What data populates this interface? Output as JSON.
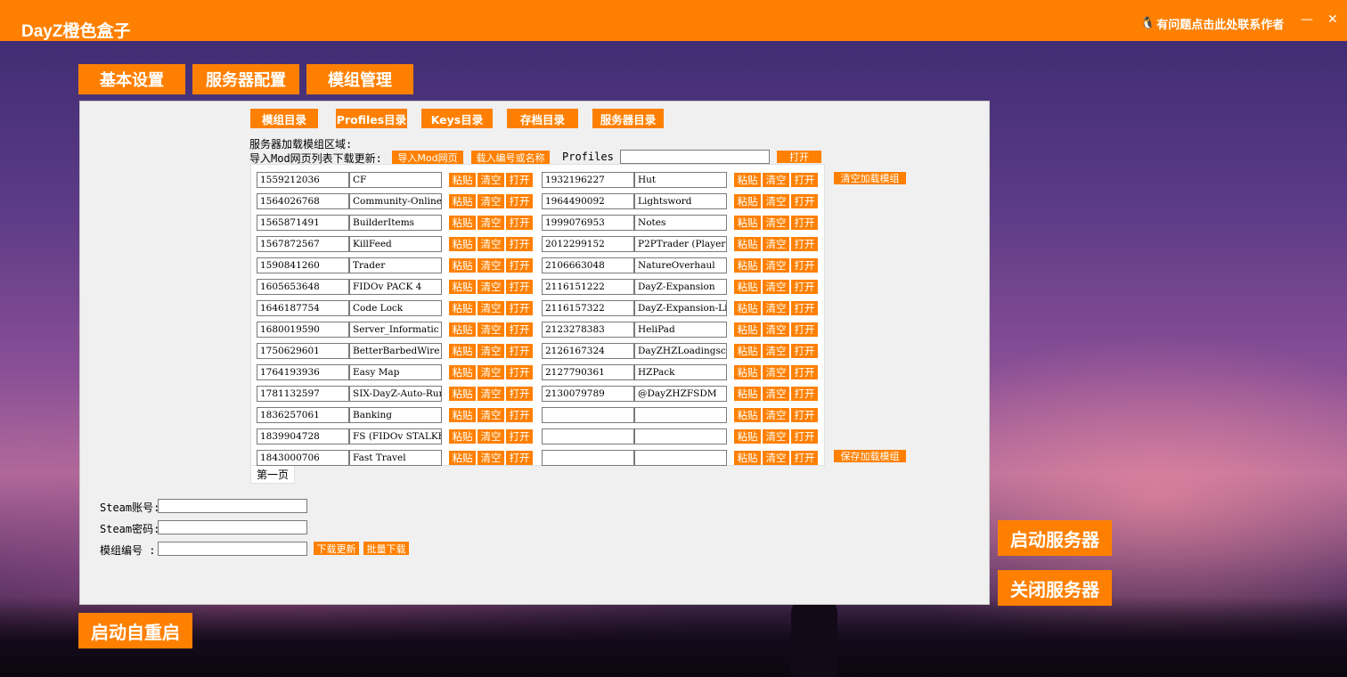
{
  "app": {
    "title": "DayZ橙色盒子",
    "contact_text": "有问题点击此处联系作者",
    "qq_icon": "qq-penguin-icon",
    "minimize": "—",
    "close": "✕"
  },
  "nav": {
    "tabs": [
      {
        "label": "基本设置"
      },
      {
        "label": "服务器配置"
      },
      {
        "label": "模组管理"
      }
    ]
  },
  "panel": {
    "dir_buttons": [
      {
        "label": "模组目录"
      },
      {
        "label": "Profiles目录"
      },
      {
        "label": "Keys目录"
      },
      {
        "label": "存档目录"
      },
      {
        "label": "服务器目录"
      }
    ],
    "load_area_label": "服务器加载模组区域:",
    "import_label": "导入Mod网页列表下载更新:",
    "import_button": "导入Mod网页",
    "load_button": "载入编号或名称",
    "profiles_label": "Profiles :",
    "profiles_value": "",
    "open_button": "打开",
    "clear_mods_button": "清空加载模组",
    "save_mods_button": "保存加载模组",
    "row_buttons": {
      "paste": "粘贴",
      "clear": "清空",
      "open": "打开"
    },
    "left_mods": [
      {
        "id": "1559212036",
        "name": "CF"
      },
      {
        "id": "1564026768",
        "name": "Community-Online-"
      },
      {
        "id": "1565871491",
        "name": "BuilderItems"
      },
      {
        "id": "1567872567",
        "name": "KillFeed"
      },
      {
        "id": "1590841260",
        "name": "Trader"
      },
      {
        "id": "1605653648",
        "name": "FIDOv PACK 4"
      },
      {
        "id": "1646187754",
        "name": "Code Lock"
      },
      {
        "id": "1680019590",
        "name": "Server_Informatic"
      },
      {
        "id": "1750629601",
        "name": "BetterBarbedWire"
      },
      {
        "id": "1764193936",
        "name": "Easy Map"
      },
      {
        "id": "1781132597",
        "name": "SIX-DayZ-Auto-Rur"
      },
      {
        "id": "1836257061",
        "name": "Banking"
      },
      {
        "id": "1839904728",
        "name": "FS (FIDOv STALKEF"
      },
      {
        "id": "1843000706",
        "name": "Fast Travel"
      }
    ],
    "right_mods": [
      {
        "id": "1932196227",
        "name": "Hut"
      },
      {
        "id": "1964490092",
        "name": "Lightsword"
      },
      {
        "id": "1999076953",
        "name": "Notes"
      },
      {
        "id": "2012299152",
        "name": "P2PTrader (Player"
      },
      {
        "id": "2106663048",
        "name": "NatureOverhaul"
      },
      {
        "id": "2116151222",
        "name": "DayZ-Expansion"
      },
      {
        "id": "2116157322",
        "name": "DayZ-Expansion-Li"
      },
      {
        "id": "2123278383",
        "name": "HeliPad"
      },
      {
        "id": "2126167324",
        "name": "DayZHZLoadingscre"
      },
      {
        "id": "2127790361",
        "name": "HZPack"
      },
      {
        "id": "2130079789",
        "name": "@DayZHZFSDM"
      },
      {
        "id": "",
        "name": ""
      },
      {
        "id": "",
        "name": ""
      },
      {
        "id": "",
        "name": ""
      }
    ],
    "page_tab": "第一页",
    "steam_account_label": "Steam账号:",
    "steam_account_value": "",
    "steam_password_label": "Steam密码:",
    "steam_password_value": "",
    "mod_id_label": "模组编号 :",
    "mod_id_value": "",
    "download_update_button": "下载更新",
    "batch_download_button": "批量下载"
  },
  "actions": {
    "start_server": "启动服务器",
    "stop_server": "关闭服务器",
    "auto_restart": "启动自重启"
  },
  "colors": {
    "accent": "#ff8000",
    "panel_bg": "#f0f0f0"
  }
}
